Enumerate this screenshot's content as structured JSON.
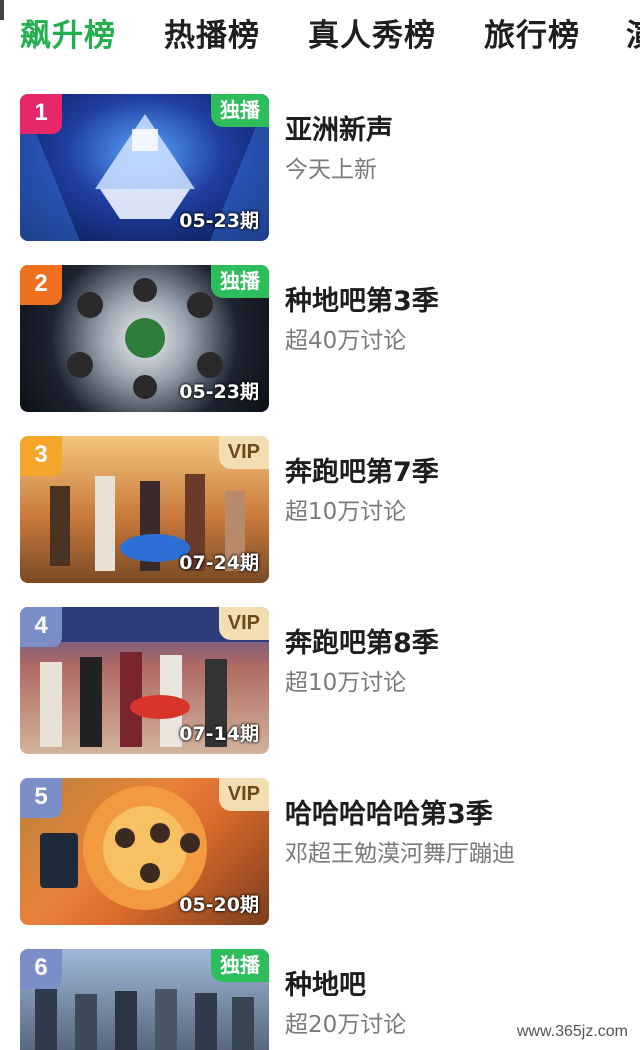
{
  "tabs": [
    {
      "label": "飙升榜",
      "active": true
    },
    {
      "label": "热播榜",
      "active": false
    },
    {
      "label": "真人秀榜",
      "active": false
    },
    {
      "label": "旅行榜",
      "active": false
    },
    {
      "label": "演",
      "active": false
    }
  ],
  "items": [
    {
      "rank": "1",
      "badge": "独播",
      "date": "05-23期",
      "title": "亚洲新声",
      "subtitle": "今天上新"
    },
    {
      "rank": "2",
      "badge": "独播",
      "date": "05-23期",
      "title": "种地吧第3季",
      "subtitle": "超40万讨论"
    },
    {
      "rank": "3",
      "badge": "VIP",
      "date": "07-24期",
      "title": "奔跑吧第7季",
      "subtitle": "超10万讨论"
    },
    {
      "rank": "4",
      "badge": "VIP",
      "date": "07-14期",
      "title": "奔跑吧第8季",
      "subtitle": "超10万讨论"
    },
    {
      "rank": "5",
      "badge": "VIP",
      "date": "05-20期",
      "title": "哈哈哈哈哈第3季",
      "subtitle": "邓超王勉漠河舞厅蹦迪"
    },
    {
      "rank": "6",
      "badge": "独播",
      "date": "",
      "title": "种地吧",
      "subtitle": "超20万讨论"
    }
  ],
  "watermark": "www.365jz.com",
  "colors": {
    "accent": "#22b04e",
    "exclusive_badge": "#2dbd5a",
    "vip_badge": "#f3ddb2"
  }
}
